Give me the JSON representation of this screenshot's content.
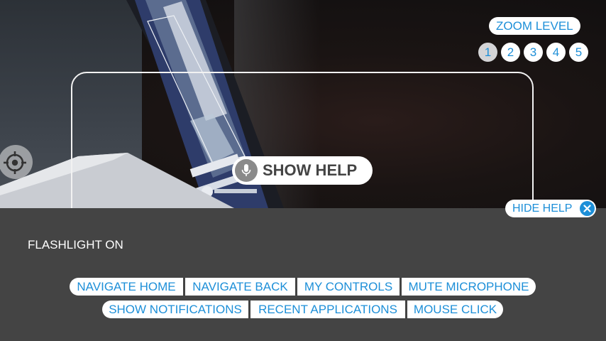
{
  "zoom": {
    "title": "ZOOM LEVEL",
    "levels": [
      "1",
      "2",
      "3",
      "4",
      "5"
    ],
    "selected": "1"
  },
  "help": {
    "show_label": "SHOW HELP",
    "hide_label": "HIDE HELP"
  },
  "status": {
    "flashlight": "FLASHLIGHT ON"
  },
  "commands": {
    "row1": [
      "NAVIGATE HOME",
      "NAVIGATE BACK",
      "MY CONTROLS",
      "MUTE MICROPHONE"
    ],
    "row2": [
      "SHOW NOTIFICATIONS",
      "RECENT APPLICATIONS",
      "MOUSE CLICK"
    ]
  },
  "colors": {
    "accent": "#1d8fd8",
    "panel": "#444444",
    "pill": "#ffffff",
    "selected_zoom": "#d4d4d6"
  },
  "icons": {
    "crosshair": "crosshair-icon",
    "microphone": "microphone-icon",
    "close": "close-icon"
  }
}
